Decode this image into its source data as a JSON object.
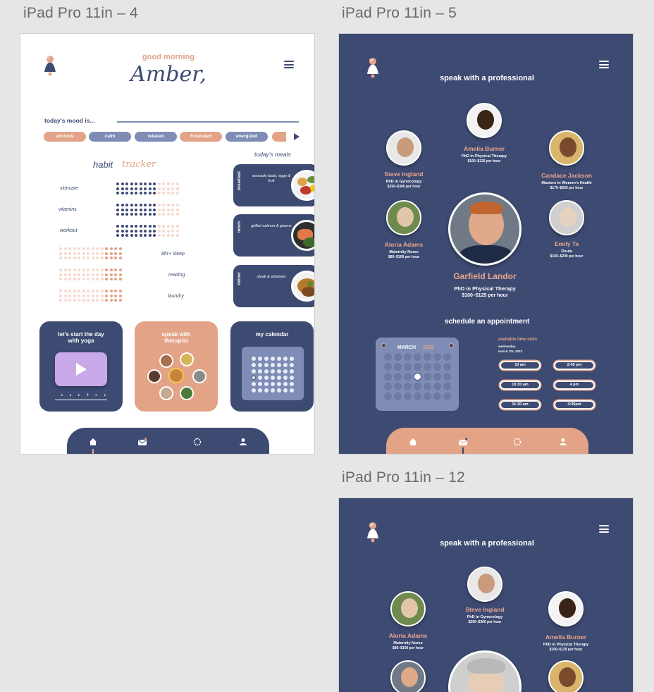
{
  "frames": [
    {
      "label": "iPad Pro 11in – 4"
    },
    {
      "label": "iPad Pro 11in – 5"
    },
    {
      "label": "iPad Pro 11in – 12"
    }
  ],
  "home": {
    "logo_badge": "24",
    "greeting": "good morning",
    "name": "Amber,",
    "mood_title": "today's mood is...",
    "moods": [
      {
        "label": "anxious",
        "color": "#e3a387"
      },
      {
        "label": "calm",
        "color": "#7f8db6"
      },
      {
        "label": "relaxed",
        "color": "#7f8db6"
      },
      {
        "label": "frustrated",
        "color": "#e3a387"
      },
      {
        "label": "energized",
        "color": "#7f8db6"
      }
    ],
    "habit_title_a": "habit",
    "habit_title_b": "tracker",
    "habits_left": [
      "skincare",
      "vitamins",
      "workout"
    ],
    "habits_right": [
      "8hr+ sleep",
      "reading",
      "laundry"
    ],
    "meals_title": "today's meals",
    "meals": [
      {
        "tag": "breakfast",
        "desc": "avocado toast, eggs & fruit"
      },
      {
        "tag": "lunch",
        "desc": "grilled salmon & greens"
      },
      {
        "tag": "dinner",
        "desc": "steak & potatoes"
      }
    ],
    "cards": {
      "yoga": "let's start the day with yoga",
      "therapist": "speak with therapist",
      "calendar": "my calendar"
    },
    "colors": {
      "navy": "#3d4a72",
      "peach": "#e3a387",
      "periwinkle": "#7f8db6"
    }
  },
  "professional": {
    "title": "speak with a professional",
    "people": [
      {
        "name": "Amelia Burner",
        "role": "PhD in Physical Therapy",
        "price": "$100–$125 per hour"
      },
      {
        "name": "Steve Ingland",
        "role": "PhD in Gynocology",
        "price": "$250–$300 per hour"
      },
      {
        "name": "Candace Jackson",
        "role": "Masters in Women's Health",
        "price": "$175–$220 per hour"
      },
      {
        "name": "Aloria Adams",
        "role": "Maternity Nurse",
        "price": "$80–$100 per hour"
      },
      {
        "name": "Emily Ta",
        "role": "Doula",
        "price": "$150–$200 per hour"
      },
      {
        "name": "Garfield Landor",
        "role": "PhD in Physical Therapy",
        "price": "$100–$125 per hour"
      }
    ],
    "schedule_title": "schedule an appointment",
    "calendar_month": "MARCH",
    "calendar_year": "2022",
    "slots_title": "available time slots",
    "slots_day": "wednesday",
    "slots_date": "march 7th, 2022",
    "slots": [
      "10 am",
      "2:45 pm",
      "10:30 am",
      "4 pm",
      "11:30 am",
      "4:30pm"
    ]
  },
  "professional2": {
    "title": "speak with a professional",
    "people": [
      {
        "name": "Steve Ingland",
        "role": "PhD in Gynocology",
        "price": "$250–$300 per hour"
      },
      {
        "name": "Aloria Adams",
        "role": "Maternity Nurse",
        "price": "$80–$100 per hour"
      },
      {
        "name": "Amelia Burner",
        "role": "PhD in Physical Therapy",
        "price": "$100–$125 per hour"
      }
    ]
  }
}
